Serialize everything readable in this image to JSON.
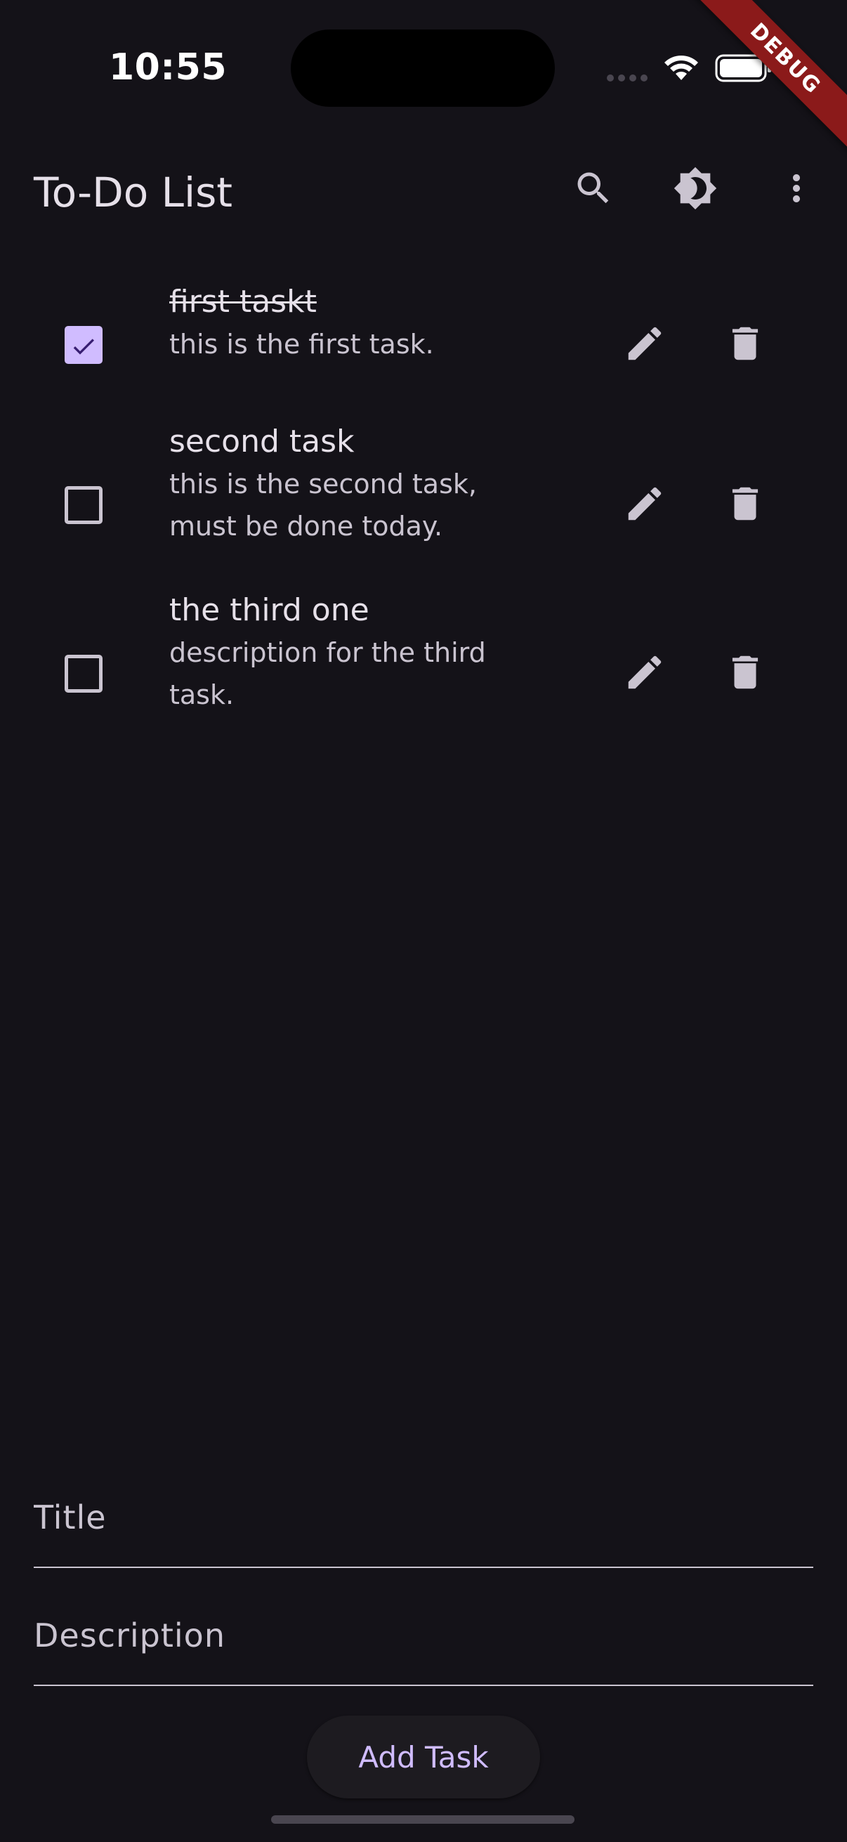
{
  "status_bar": {
    "time": "10:55",
    "debug_label": "DEBUG"
  },
  "app_bar": {
    "title": "To-Do List",
    "actions": [
      "search-icon",
      "brightness-icon",
      "more-vert-icon"
    ]
  },
  "tasks": [
    {
      "title": "first taskt",
      "description": "this is the first task.",
      "completed": true
    },
    {
      "title": "second task",
      "description": "this is the second task, must be done today.",
      "completed": false
    },
    {
      "title": "the third one",
      "description": "description for the third task.",
      "completed": false
    }
  ],
  "form": {
    "title_placeholder": "Title",
    "description_placeholder": "Description",
    "add_button_label": "Add Task"
  },
  "colors": {
    "background": "#141218",
    "accent": "#d0bcff",
    "debug_banner": "#8b1a1a"
  }
}
